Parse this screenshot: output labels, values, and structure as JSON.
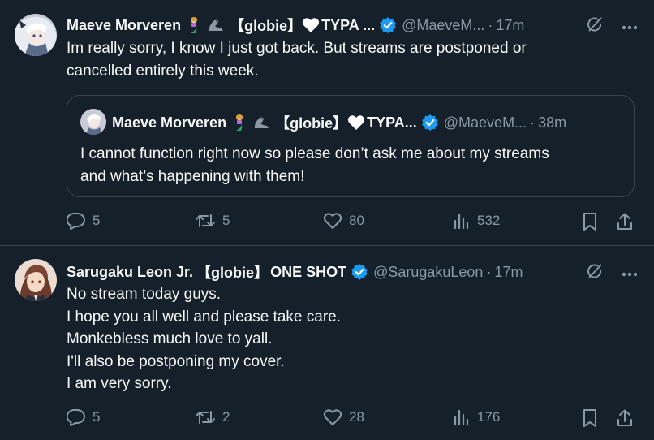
{
  "tweets": [
    {
      "author_name": "Maeve Morveren",
      "name_tag": "【globie】",
      "name_suffix": "TYPA ...",
      "handle": "@MaeveM...",
      "time": "17m",
      "body_lines": [
        "Im really sorry, I know I just got back. But streams are postponed or",
        "cancelled entirely this week."
      ],
      "quote": {
        "author_name": "Maeve Morveren",
        "name_tag": "【globie】",
        "name_suffix": "TYPA...",
        "handle": "@MaeveM...",
        "time": "38m",
        "body_lines": [
          "I cannot function right now so please don’t ask me about my streams",
          "and what’s happening with them!"
        ]
      },
      "replies": "5",
      "reposts": "5",
      "likes": "80",
      "views": "532"
    },
    {
      "author_name": "Sarugaku Leon Jr.",
      "name_tag": "【globie】",
      "name_suffix": "ONE SHOT",
      "handle": "@SarugakuLeon",
      "time": "17m",
      "body_lines": [
        "No stream today guys.",
        "I hope you all well and please take care.",
        "Monkebless much love to yall.",
        "I'll also be postponing my cover.",
        "I am very sorry."
      ],
      "replies": "5",
      "reposts": "2",
      "likes": "28",
      "views": "176"
    }
  ],
  "separator": "·",
  "colors": {
    "background": "#15202b",
    "text": "#f7f9f9",
    "muted": "#8b98a5",
    "border": "#38444d",
    "verified": "#1d9bf0"
  },
  "icons": [
    "mermaid-emoji",
    "seal-emoji",
    "white-heart-emoji",
    "verified-badge-icon",
    "grok-icon",
    "more-icon",
    "reply-icon",
    "repost-icon",
    "like-icon",
    "views-icon",
    "bookmark-icon",
    "share-icon"
  ]
}
